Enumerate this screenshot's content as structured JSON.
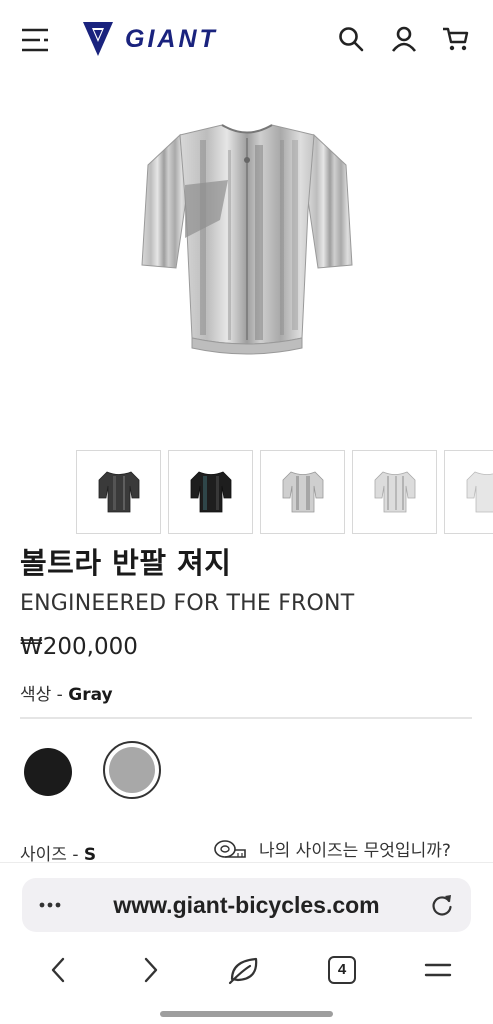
{
  "header": {
    "brand": "GIANT",
    "icons": [
      "menu-icon",
      "search-icon",
      "account-icon",
      "cart-icon"
    ]
  },
  "product": {
    "name": "볼트라 반팔 져지",
    "tagline": "ENGINEERED FOR THE FRONT",
    "price": "₩200,000",
    "color_label": "색상 - ",
    "color_value": "Gray",
    "size_label": "사이즈 - ",
    "size_value": "S",
    "size_guide": "나의 사이즈는 무엇입니까?",
    "thumbnails": [
      "jersey-dark-thumb",
      "jersey-black-thumb",
      "jersey-gray-thumb",
      "jersey-light-thumb"
    ],
    "swatches": [
      {
        "name": "black",
        "color": "#1b1b1b",
        "selected": false
      },
      {
        "name": "gray",
        "color": "#a8a8a8",
        "selected": true
      }
    ]
  },
  "browser": {
    "url": "www.giant-bicycles.com",
    "tab_count": "4"
  },
  "colors": {
    "brand_blue": "#1a237e",
    "text": "#1a1a1a",
    "url_pill": "#f1f0f3"
  }
}
